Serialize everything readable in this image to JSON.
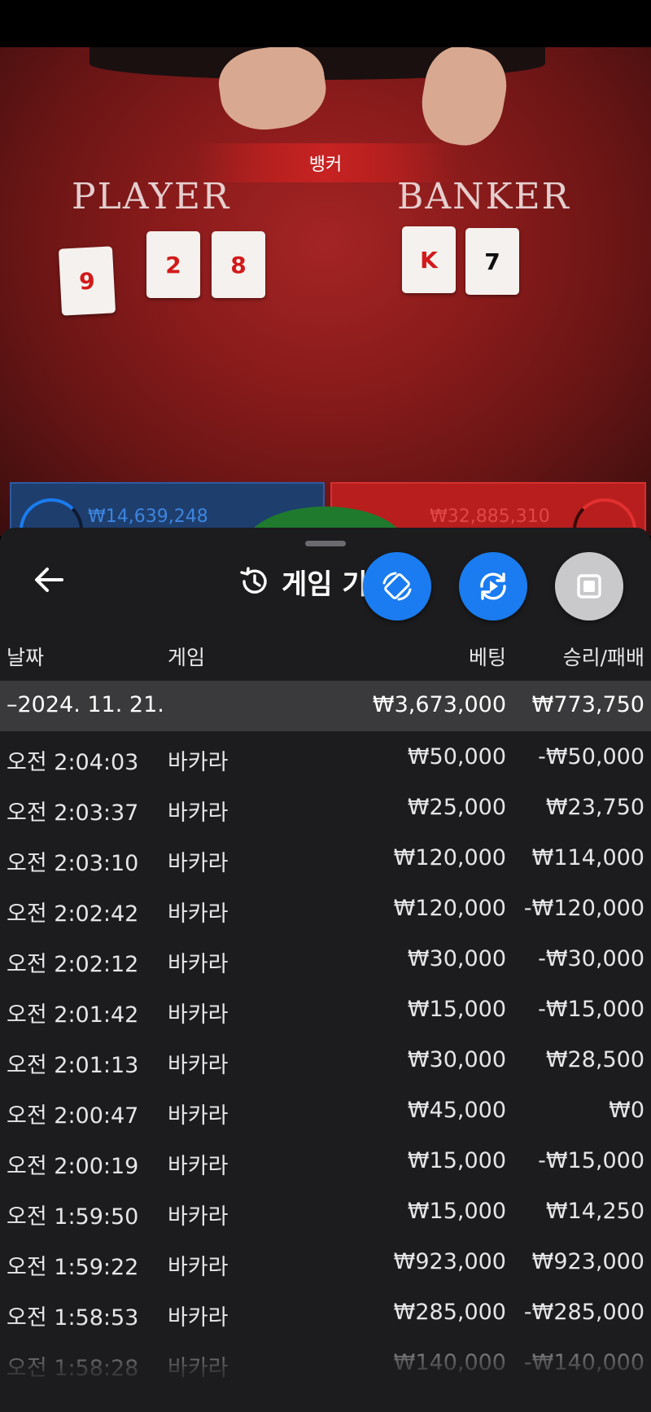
{
  "video": {
    "banner": "뱅커",
    "player_label": "PLAYER",
    "banker_label": "BANKER",
    "player_cards": [
      "9",
      "2",
      "8"
    ],
    "banker_cards": [
      "K",
      "7"
    ],
    "player_bet_total": "₩14,639,248",
    "banker_bet_total": "₩32,885,310"
  },
  "sheet": {
    "title": "게임 기록",
    "icons": {
      "back": "arrow-left-icon",
      "history": "history-clock-icon",
      "fab1": "rotate-screen-icon",
      "fab2": "replay-icon",
      "fab3": "stop-square-icon"
    },
    "colors": {
      "fab_blue": "#1a7cf0",
      "fab_grey": "#c9c9cb",
      "group_bg": "#3a3a3c"
    },
    "columns": {
      "date": "날짜",
      "game": "게임",
      "bet": "베팅",
      "winloss": "승리/패배"
    },
    "group": {
      "date": "–2024. 11. 21.",
      "bet": "₩3,673,000",
      "winloss": "₩773,750"
    },
    "rows": [
      {
        "time": "오전 2:04:03",
        "game": "바카라",
        "bet": "₩50,000",
        "winloss": "-₩50,000"
      },
      {
        "time": "오전 2:03:37",
        "game": "바카라",
        "bet": "₩25,000",
        "winloss": "₩23,750"
      },
      {
        "time": "오전 2:03:10",
        "game": "바카라",
        "bet": "₩120,000",
        "winloss": "₩114,000"
      },
      {
        "time": "오전 2:02:42",
        "game": "바카라",
        "bet": "₩120,000",
        "winloss": "-₩120,000"
      },
      {
        "time": "오전 2:02:12",
        "game": "바카라",
        "bet": "₩30,000",
        "winloss": "-₩30,000"
      },
      {
        "time": "오전 2:01:42",
        "game": "바카라",
        "bet": "₩15,000",
        "winloss": "-₩15,000"
      },
      {
        "time": "오전 2:01:13",
        "game": "바카라",
        "bet": "₩30,000",
        "winloss": "₩28,500"
      },
      {
        "time": "오전 2:00:47",
        "game": "바카라",
        "bet": "₩45,000",
        "winloss": "₩0"
      },
      {
        "time": "오전 2:00:19",
        "game": "바카라",
        "bet": "₩15,000",
        "winloss": "-₩15,000"
      },
      {
        "time": "오전 1:59:50",
        "game": "바카라",
        "bet": "₩15,000",
        "winloss": "₩14,250"
      },
      {
        "time": "오전 1:59:22",
        "game": "바카라",
        "bet": "₩923,000",
        "winloss": "₩923,000"
      },
      {
        "time": "오전 1:58:53",
        "game": "바카라",
        "bet": "₩285,000",
        "winloss": "-₩285,000"
      },
      {
        "time": "오전 1:58:28",
        "game": "바카라",
        "bet": "₩140,000",
        "winloss": "-₩140,000"
      }
    ]
  }
}
